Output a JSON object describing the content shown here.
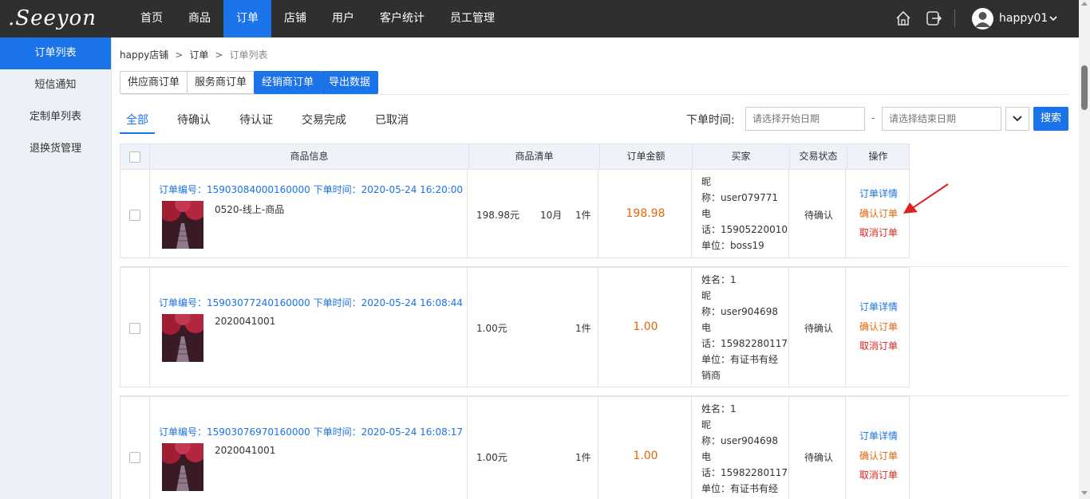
{
  "app": {
    "logo_text": ".Seeyon"
  },
  "nav": {
    "items": [
      {
        "label": "首页"
      },
      {
        "label": "商品"
      },
      {
        "label": "订单",
        "active": true
      },
      {
        "label": "店铺"
      },
      {
        "label": "用户"
      },
      {
        "label": "客户统计"
      },
      {
        "label": "员工管理"
      }
    ],
    "user": "happy01"
  },
  "sidebar": {
    "items": [
      {
        "label": "订单列表",
        "active": true
      },
      {
        "label": "短信通知"
      },
      {
        "label": "定制单列表"
      },
      {
        "label": "退换货管理"
      }
    ]
  },
  "breadcrumb": [
    "happy店铺",
    "订单",
    "订单列表"
  ],
  "order_types": [
    {
      "label": "供应商订单",
      "active": false
    },
    {
      "label": "服务商订单",
      "active": false
    },
    {
      "label": "经销商订单",
      "active": true
    },
    {
      "label": "导出数据",
      "active": true
    }
  ],
  "tabs": [
    {
      "label": "全部",
      "active": true
    },
    {
      "label": "待确认"
    },
    {
      "label": "待认证"
    },
    {
      "label": "交易完成"
    },
    {
      "label": "已取消"
    }
  ],
  "filter": {
    "label": "下单时间:",
    "start_placeholder": "请选择开始日期",
    "end_placeholder": "请选择结束日期",
    "dash": "-",
    "search_label": "搜索"
  },
  "table": {
    "headers": [
      "商品信息",
      "商品清单",
      "订单金额",
      "买家",
      "交易状态",
      "操作"
    ]
  },
  "ops": {
    "detail": "订单详情",
    "confirm": "确认订单",
    "cancel": "取消订单"
  },
  "orders": [
    {
      "meta": "订单编号：15903084000160000 下单时间：2020-05-24 16:20:00",
      "name": "0520-线上-商品",
      "price": "198.98元",
      "spec": "10月",
      "qty": "1件",
      "amount": "198.98",
      "buyer": [
        "昵",
        "称：user079771",
        "电",
        "话：15905220010",
        "单位：boss19"
      ],
      "status": "待确认"
    },
    {
      "meta": "订单编号：15903077240160000 下单时间：2020-05-24 16:08:44",
      "name": "2020041001",
      "price": "1.00元",
      "spec": "",
      "qty": "1件",
      "amount": "1.00",
      "buyer": [
        "姓名：1",
        "昵",
        "称：user904698",
        "电",
        "话：15982280117",
        "单位：有证书有经",
        "销商"
      ],
      "status": "待确认"
    },
    {
      "meta": "订单编号：15903076970160000 下单时间：2020-05-24 16:08:17",
      "name": "2020041001",
      "price": "1.00元",
      "spec": "",
      "qty": "1件",
      "amount": "1.00",
      "buyer": [
        "姓名：1",
        "昵",
        "称：user904698",
        "电",
        "话：15982280117",
        "单位：有证书有经"
      ],
      "status": "待确认"
    }
  ],
  "colors": {
    "primary": "#1a73e8",
    "topbar": "#2f2f2f",
    "amount": "#e8650b",
    "cancel": "#e0261d",
    "annotation": "#e02020"
  }
}
